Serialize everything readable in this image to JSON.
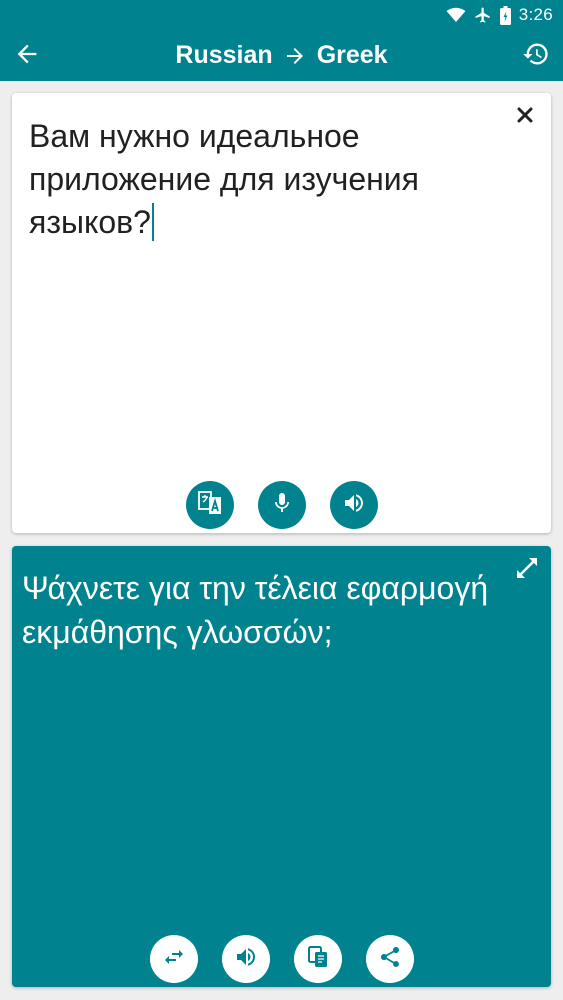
{
  "status_bar": {
    "time": "3:26",
    "icons": [
      "wifi-icon",
      "airplane-mode-icon",
      "battery-icon"
    ]
  },
  "app_bar": {
    "source_language": "Russian",
    "target_language": "Greek",
    "icons": [
      "back-arrow-icon",
      "swap-direction-arrow-icon",
      "history-icon"
    ]
  },
  "source": {
    "text": "Вам нужно идеальное приложение для изучения языков?",
    "icons": [
      "clear-icon",
      "translate-icon",
      "microphone-icon",
      "speaker-icon"
    ]
  },
  "target": {
    "text": "Ψάχνετε για την τέλεια εφαρμογή εκμάθησης γλωσσών;",
    "icons": [
      "expand-icon",
      "swap-icon",
      "speaker-icon",
      "copy-icon",
      "share-icon"
    ]
  },
  "colors": {
    "primary": "#00828f",
    "background": "#eeeeee",
    "card": "#ffffff",
    "text_dark": "#212121"
  }
}
